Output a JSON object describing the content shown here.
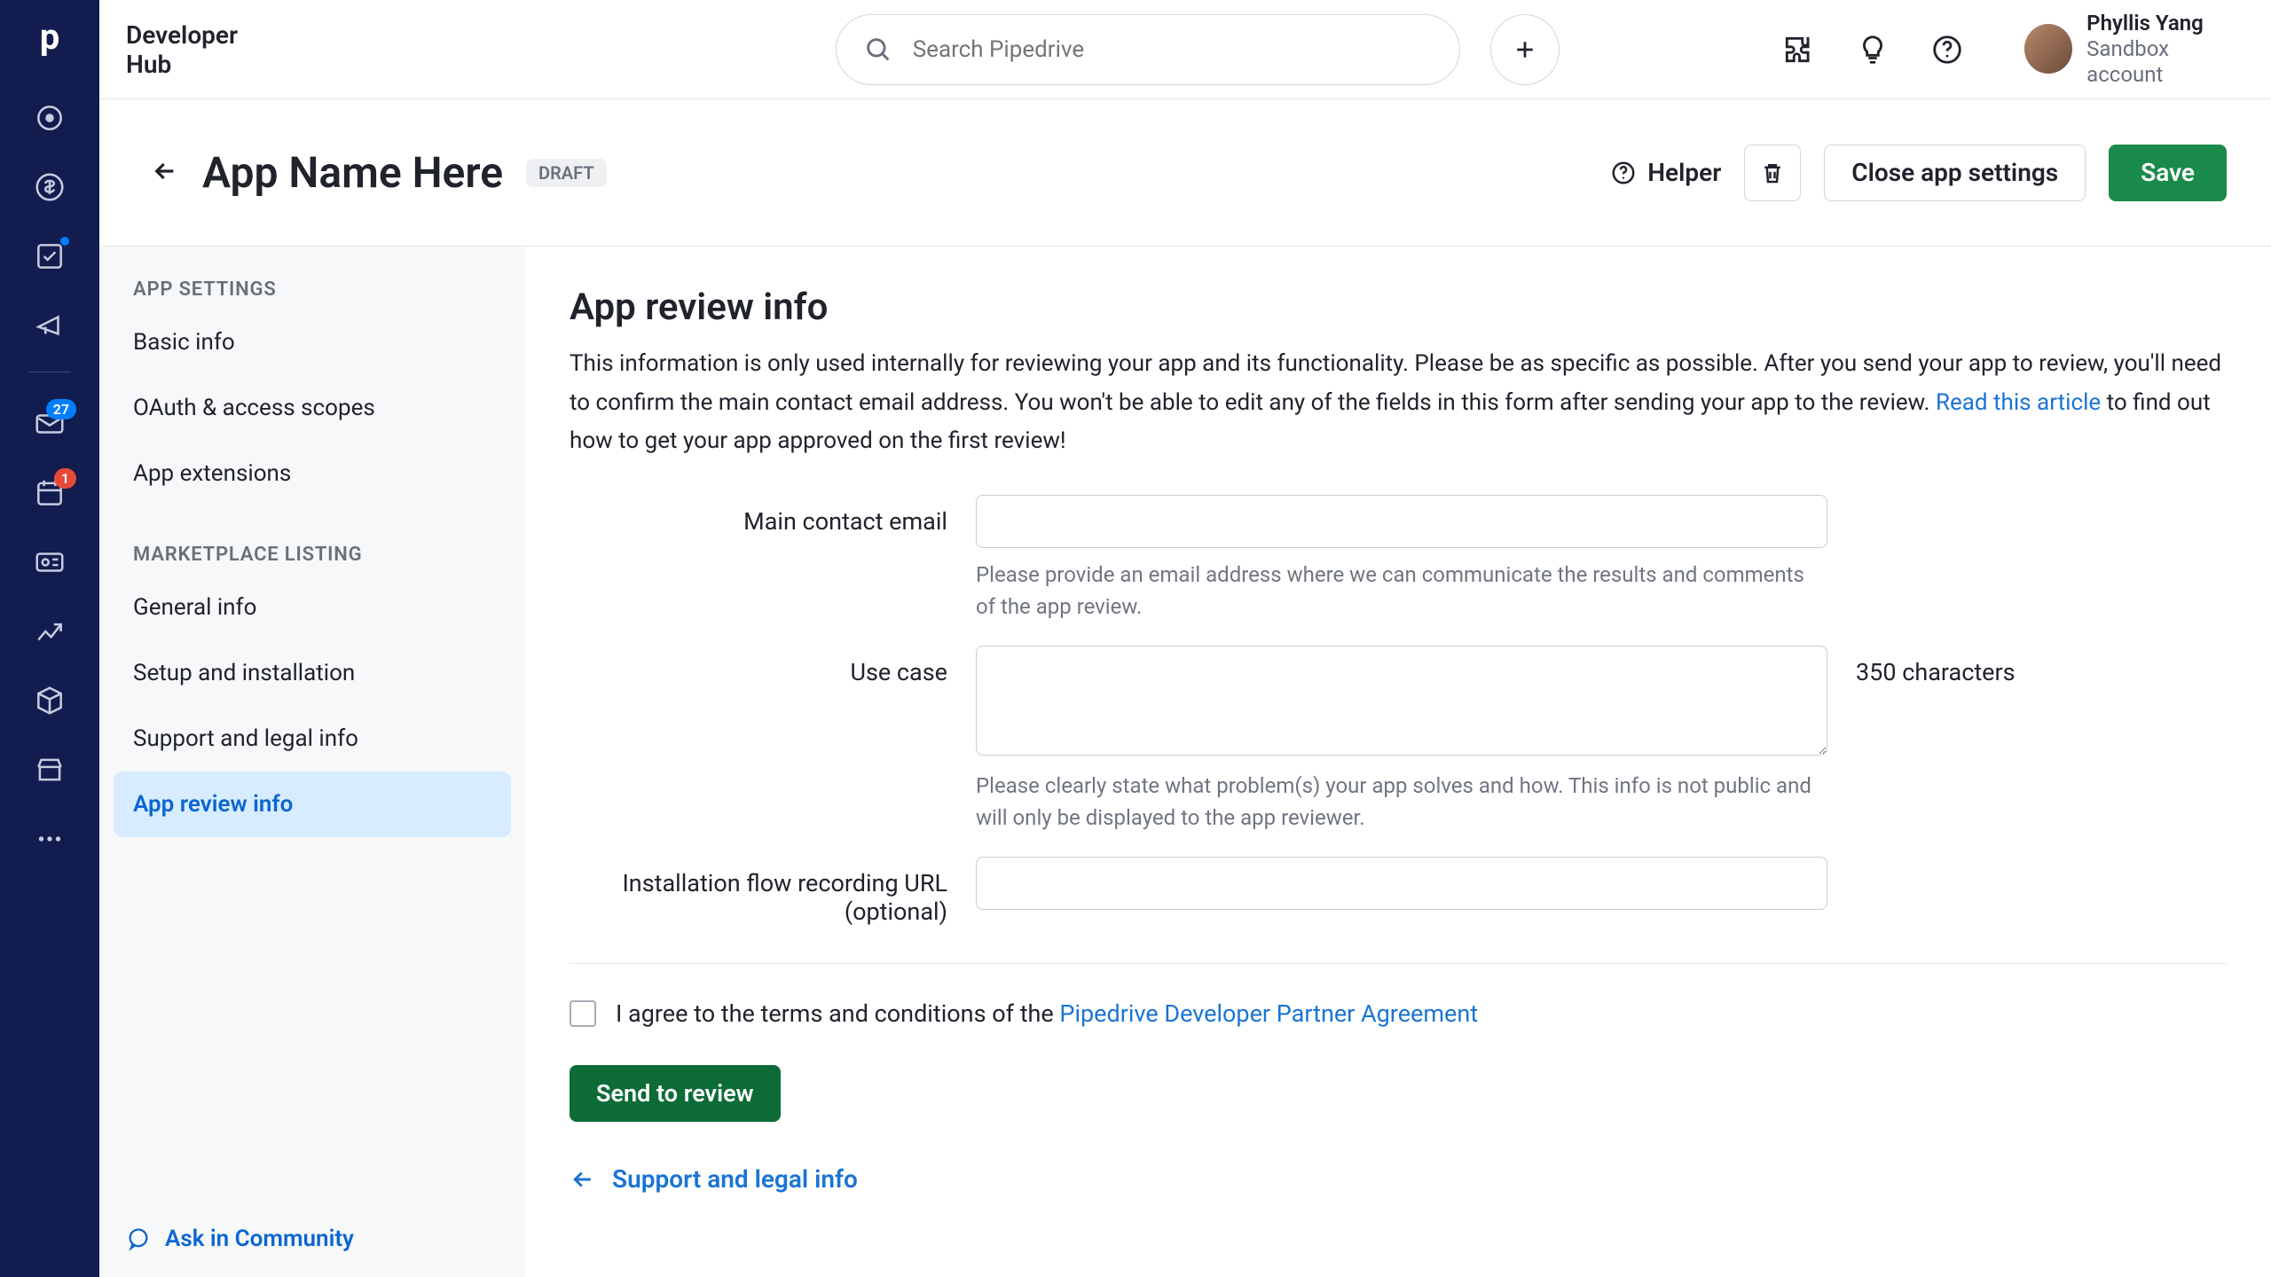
{
  "topbar": {
    "hub_title": "Developer Hub",
    "search_placeholder": "Search Pipedrive",
    "user_name": "Phyllis Yang",
    "user_role": "Sandbox account"
  },
  "vnav": {
    "badge_mail": "27",
    "badge_cal": "1"
  },
  "page_head": {
    "title": "App Name Here",
    "status": "DRAFT",
    "helper": "Helper",
    "close": "Close app settings",
    "save": "Save"
  },
  "sidebar": {
    "section_a": "APP SETTINGS",
    "items_a": [
      "Basic info",
      "OAuth & access scopes",
      "App extensions"
    ],
    "section_b": "MARKETPLACE LISTING",
    "items_b": [
      "General info",
      "Setup and installation",
      "Support and legal info",
      "App review info"
    ],
    "active_index_b": 3,
    "footer": "Ask in Community"
  },
  "content": {
    "heading": "App review info",
    "desc_1": "This information is only used internally for reviewing your app and its functionality. Please be as specific as possible. After you send your app to review, you'll need to confirm the main contact email address. You won't be able to edit any of the fields in this form after sending your app to the review. ",
    "desc_link": "Read this article",
    "desc_2": " to find out how to get your app approved on the first review!",
    "fields": {
      "email_label": "Main contact email",
      "email_help": "Please provide an email address where we can communicate the results and comments of the app review.",
      "usecase_label": "Use case",
      "usecase_side": "350 characters",
      "usecase_help": "Please clearly state what problem(s) your app solves and how. This info is not public and will only be displayed to the app reviewer.",
      "install_label": "Installation flow recording URL",
      "install_opt": "(optional)"
    },
    "terms_prefix": "I agree to the terms and conditions of the ",
    "terms_link": "Pipedrive Developer Partner Agreement",
    "send_btn": "Send to review",
    "prev_link": "Support and legal info"
  }
}
